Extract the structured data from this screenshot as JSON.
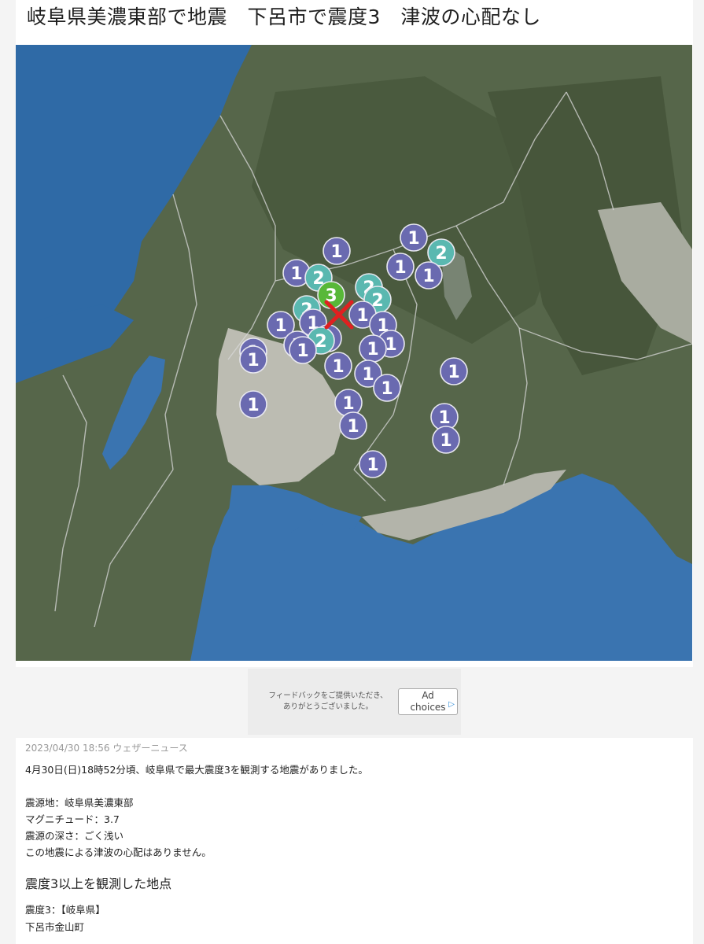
{
  "headline": "岐阜県美濃東部で地震　下呂市で震度3　津波の心配なし",
  "map": {
    "colors": {
      "sea": "#3c78b4",
      "land": "#5a6a4c",
      "plain": "#c4c4ba",
      "intensity_1": "#6a6ab0",
      "intensity_2": "#5ab8b0",
      "intensity_3": "#58b838",
      "epicenter": "#e02020"
    },
    "epicenter_icon": "x-mark-icon",
    "markers": [
      {
        "label": "1"
      },
      {
        "label": "1"
      },
      {
        "label": "2"
      },
      {
        "label": "1"
      },
      {
        "label": "1"
      },
      {
        "label": "2"
      },
      {
        "label": "1"
      },
      {
        "label": "2"
      },
      {
        "label": "2"
      },
      {
        "label": "3"
      },
      {
        "label": "2"
      },
      {
        "label": "1"
      },
      {
        "label": "1"
      },
      {
        "label": "1"
      },
      {
        "label": "1"
      },
      {
        "label": "1"
      },
      {
        "label": "2"
      },
      {
        "label": "1"
      },
      {
        "label": "1"
      },
      {
        "label": "1"
      },
      {
        "label": "1"
      },
      {
        "label": "1"
      },
      {
        "label": "1"
      },
      {
        "label": "1"
      },
      {
        "label": "1"
      },
      {
        "label": "1"
      },
      {
        "label": "1"
      },
      {
        "label": "1"
      },
      {
        "label": "1"
      },
      {
        "label": "1"
      },
      {
        "label": "1"
      },
      {
        "label": "1"
      },
      {
        "label": "1"
      }
    ]
  },
  "ad": {
    "text_line1": "フィードバックをご提供いただき、",
    "text_line2": "ありがとうございました。",
    "button_line1": "Ad",
    "button_line2": "choices",
    "icon": "adchoices-triangle-icon"
  },
  "article": {
    "meta": "2023/04/30 18:56 ウェザーニュース",
    "lead": "4月30日(日)18時52分頃、岐阜県で最大震度3を観測する地震がありました。",
    "details": [
      "震源地：岐阜県美濃東部",
      "マグニチュード：3.7",
      "震源の深さ：ごく浅い",
      "この地震による津波の心配はありません。"
    ],
    "section_title": "震度3以上を観測した地点",
    "section_lines": [
      "震度3：【岐阜県】",
      "下呂市金山町"
    ]
  }
}
